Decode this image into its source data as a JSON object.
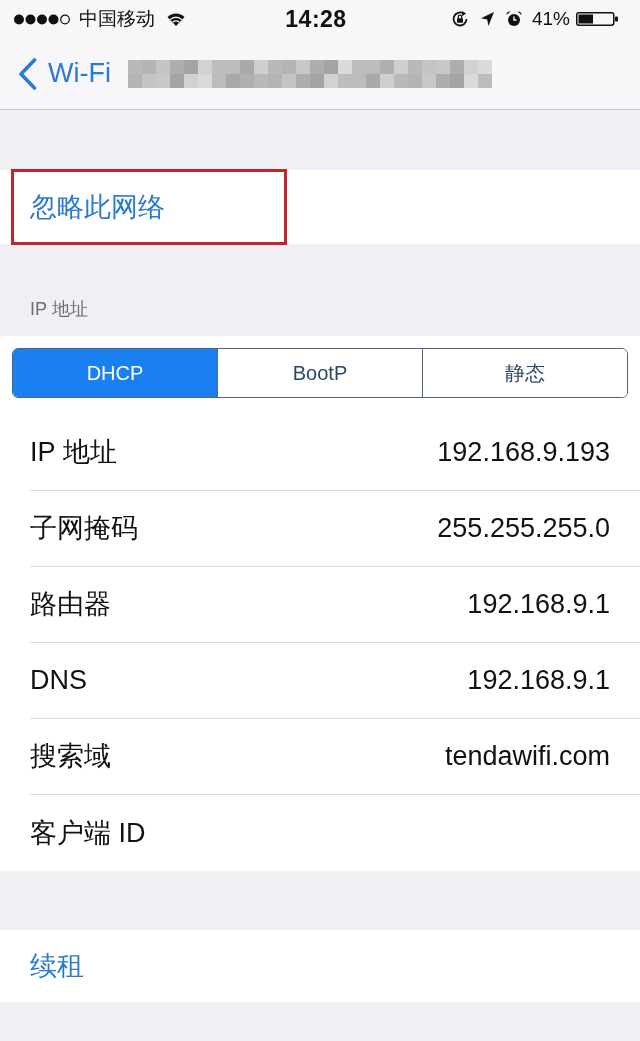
{
  "status_bar": {
    "carrier": "中国移动",
    "time": "14:28",
    "battery_percent": "41%"
  },
  "nav_bar": {
    "back_label": "Wi-Fi"
  },
  "forget_row": {
    "label": "忽略此网络",
    "highlighted": true
  },
  "ip_section": {
    "header": "IP 地址",
    "segments": [
      {
        "label": "DHCP",
        "selected": true
      },
      {
        "label": "BootP",
        "selected": false
      },
      {
        "label": "静态",
        "selected": false
      }
    ],
    "rows": [
      {
        "label": "IP 地址",
        "value": "192.168.9.193"
      },
      {
        "label": "子网掩码",
        "value": "255.255.255.0"
      },
      {
        "label": "路由器",
        "value": "192.168.9.1"
      },
      {
        "label": "DNS",
        "value": "192.168.9.1"
      },
      {
        "label": "搜索域",
        "value": "tendawifi.com"
      },
      {
        "label": "客户端 ID"
      }
    ]
  },
  "renew_row": {
    "label": "续租"
  }
}
